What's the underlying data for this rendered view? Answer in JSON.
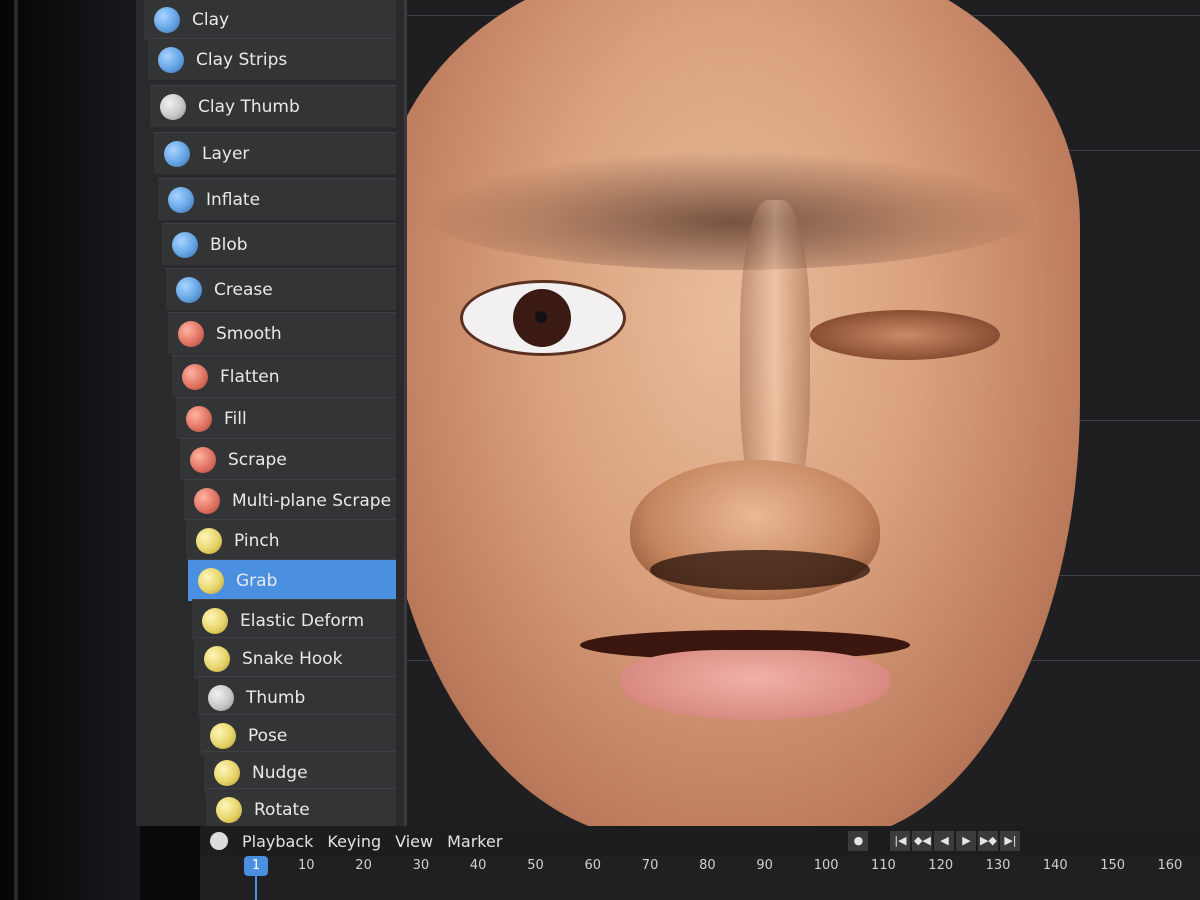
{
  "tools": [
    {
      "label": "Clay",
      "icon": "clay-brush-icon",
      "color": "blue",
      "active": false
    },
    {
      "label": "Clay Strips",
      "icon": "clay-strips-brush-icon",
      "color": "blue",
      "active": false
    },
    {
      "label": "Clay Thumb",
      "icon": "clay-thumb-brush-icon",
      "color": "gray",
      "active": false
    },
    {
      "label": "Layer",
      "icon": "layer-brush-icon",
      "color": "blue",
      "active": false
    },
    {
      "label": "Inflate",
      "icon": "inflate-brush-icon",
      "color": "blue",
      "active": false
    },
    {
      "label": "Blob",
      "icon": "blob-brush-icon",
      "color": "blue",
      "active": false
    },
    {
      "label": "Crease",
      "icon": "crease-brush-icon",
      "color": "blue",
      "active": false
    },
    {
      "label": "Smooth",
      "icon": "smooth-brush-icon",
      "color": "red",
      "active": false
    },
    {
      "label": "Flatten",
      "icon": "flatten-brush-icon",
      "color": "red",
      "active": false
    },
    {
      "label": "Fill",
      "icon": "fill-brush-icon",
      "color": "red",
      "active": false
    },
    {
      "label": "Scrape",
      "icon": "scrape-brush-icon",
      "color": "red",
      "active": false
    },
    {
      "label": "Multi-plane Scrape",
      "icon": "multiplane-scrape-brush-icon",
      "color": "red",
      "active": false
    },
    {
      "label": "Pinch",
      "icon": "pinch-brush-icon",
      "color": "yellow",
      "active": false
    },
    {
      "label": "Grab",
      "icon": "grab-brush-icon",
      "color": "yellow",
      "active": true
    },
    {
      "label": "Elastic Deform",
      "icon": "elastic-deform-brush-icon",
      "color": "yellow",
      "active": false
    },
    {
      "label": "Snake Hook",
      "icon": "snake-hook-brush-icon",
      "color": "yellow",
      "active": false
    },
    {
      "label": "Thumb",
      "icon": "thumb-brush-icon",
      "color": "gray",
      "active": false
    },
    {
      "label": "Pose",
      "icon": "pose-brush-icon",
      "color": "yellow",
      "active": false
    },
    {
      "label": "Nudge",
      "icon": "nudge-brush-icon",
      "color": "yellow",
      "active": false
    },
    {
      "label": "Rotate",
      "icon": "rotate-brush-icon",
      "color": "yellow",
      "active": false
    }
  ],
  "timeline": {
    "menus": [
      "Playback",
      "Keying",
      "View",
      "Marker"
    ],
    "current_frame": "1",
    "ruler_ticks": [
      "10",
      "20",
      "30",
      "40",
      "50",
      "60",
      "70",
      "80",
      "90",
      "100",
      "110",
      "120",
      "130",
      "140",
      "150",
      "160"
    ],
    "controls": [
      "jump-start-icon",
      "prev-keyframe-icon",
      "play-reverse-icon",
      "play-icon",
      "next-keyframe-icon",
      "jump-end-icon"
    ]
  },
  "colors": {
    "active": "#4a8fe0",
    "panel": "#333436",
    "blue": "#6aa9e8",
    "red": "#e07362",
    "yellow": "#e6d46a",
    "gray": "#c8c8c8"
  }
}
